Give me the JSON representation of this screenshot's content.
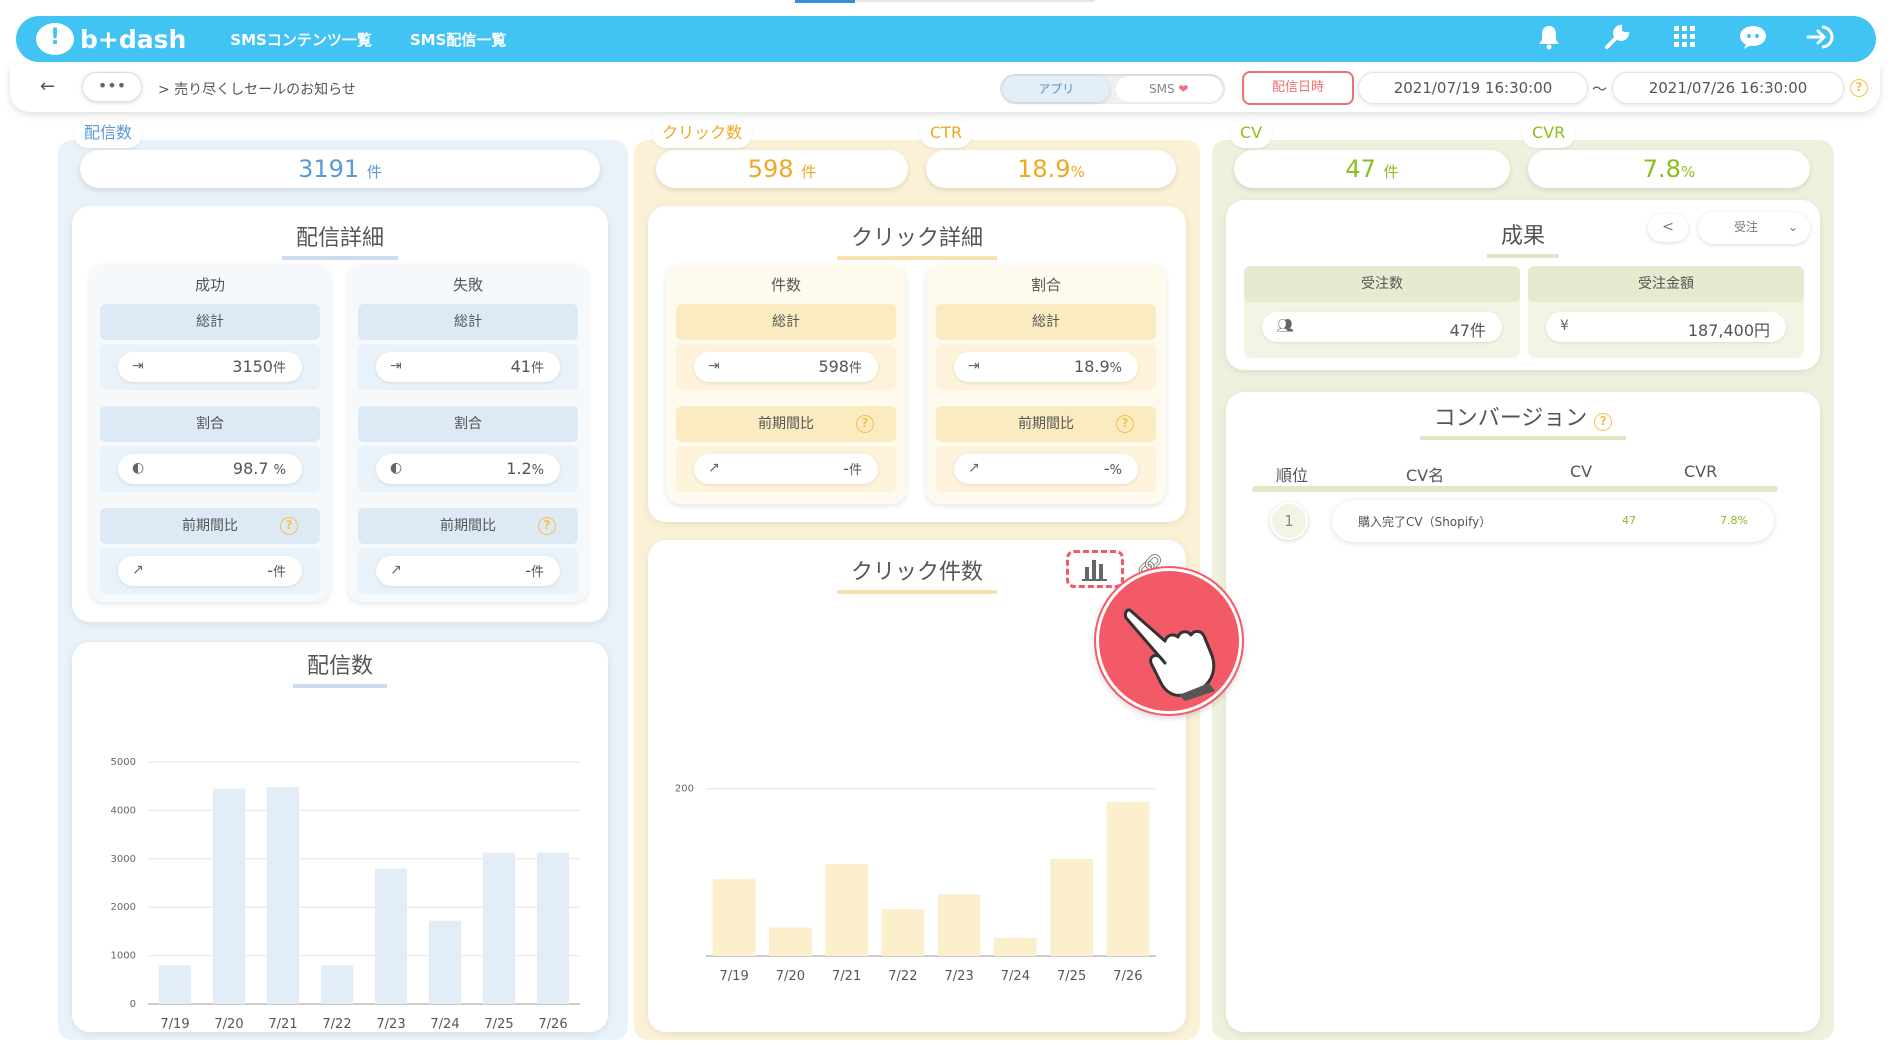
{
  "header": {
    "logo_text": "b+dash",
    "nav": [
      "SMSコンテンツ一覧",
      "SMS配信一覧"
    ]
  },
  "subbar": {
    "back": "←",
    "more": "•••",
    "breadcrumb": "> 売り尽くしセールのお知らせ",
    "toggle": [
      "アプリ",
      "SMS"
    ],
    "date_button": "配信日時",
    "date_from": "2021/07/19 16:30:00",
    "tilde": "〜",
    "date_to": "2021/07/26 16:30:00"
  },
  "metrics": {
    "delivery": {
      "label": "配信数",
      "value": "3191",
      "unit": "件"
    },
    "clicks": {
      "label": "クリック数",
      "value": "598",
      "unit": "件"
    },
    "ctr": {
      "label": "CTR",
      "value": "18.9",
      "unit": "%"
    },
    "cv": {
      "label": "CV",
      "value": "47",
      "unit": "件"
    },
    "cvr": {
      "label": "CVR",
      "value": "7.8",
      "unit": "%"
    }
  },
  "delivery_detail": {
    "title": "配信詳細",
    "success": {
      "head": "成功",
      "total_label": "総計",
      "total": "3150",
      "total_unit": "件",
      "ratio_label": "割合",
      "ratio": "98.7",
      "ratio_unit": "%",
      "prev_label": "前期間比",
      "prev": "-",
      "prev_unit": "件"
    },
    "failure": {
      "head": "失敗",
      "total_label": "総計",
      "total": "41",
      "total_unit": "件",
      "ratio_label": "割合",
      "ratio": "1.2",
      "ratio_unit": "%",
      "prev_label": "前期間比",
      "prev": "-",
      "prev_unit": "件"
    }
  },
  "click_detail": {
    "title": "クリック詳細",
    "count": {
      "head": "件数",
      "total_label": "総計",
      "total": "598",
      "total_unit": "件",
      "prev_label": "前期間比",
      "prev": "-",
      "prev_unit": "件"
    },
    "ratio": {
      "head": "割合",
      "total_label": "総計",
      "total": "18.9",
      "total_unit": "%",
      "prev_label": "前期間比",
      "prev": "-",
      "prev_unit": "%"
    }
  },
  "results": {
    "title": "成果",
    "dropdown": "受注",
    "orders_label": "受注数",
    "orders": "47件",
    "amount_label": "受注金額",
    "amount": "187,400円"
  },
  "conversion": {
    "title": "コンバージョン",
    "headers": [
      "順位",
      "CV名",
      "CV",
      "CVR"
    ],
    "rows": [
      {
        "rank": "1",
        "name": "購入完了CV（Shopify）",
        "cv": "47",
        "cvr": "7.8%"
      }
    ]
  },
  "colors": {
    "header": "#41c3f4",
    "blue": "#5b9bd5",
    "yellow": "#f0a722",
    "green": "#8cbd1e",
    "alert": "#f07070"
  },
  "chart_data": [
    {
      "type": "bar",
      "title": "配信数",
      "categories": [
        "7/19",
        "7/20",
        "7/21",
        "7/22",
        "7/23",
        "7/24",
        "7/25",
        "7/26"
      ],
      "values": [
        800,
        4450,
        4480,
        800,
        2800,
        1720,
        3130,
        3130
      ],
      "yticks": [
        0,
        1000,
        2000,
        3000,
        4000,
        5000
      ],
      "ylim": [
        0,
        5000
      ],
      "grid": true,
      "color": "#e3edf8"
    },
    {
      "type": "bar",
      "title": "クリック件数",
      "categories": [
        "7/19",
        "7/20",
        "7/21",
        "7/22",
        "7/23",
        "7/24",
        "7/25",
        "7/26"
      ],
      "values": [
        92,
        34,
        110,
        56,
        74,
        22,
        116,
        184
      ],
      "yticks": [
        200
      ],
      "ylim": [
        0,
        220
      ],
      "grid": true,
      "color": "#fcefcc"
    }
  ]
}
